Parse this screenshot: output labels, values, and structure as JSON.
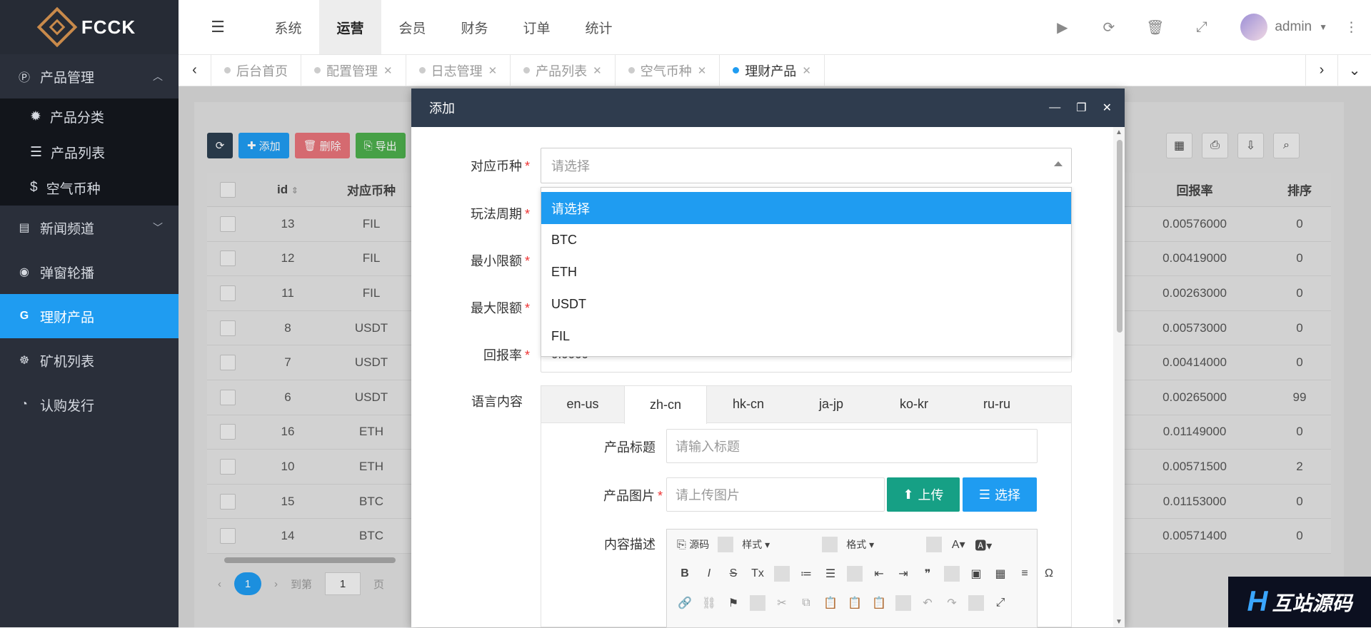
{
  "app": {
    "brand": "FCCK"
  },
  "sidebar": {
    "items": [
      {
        "label": "产品管理",
        "icon": "product-icon",
        "expanded": true
      },
      {
        "label": "新闻频道",
        "icon": "news-icon"
      },
      {
        "label": "弹窗轮播",
        "icon": "compass-icon"
      },
      {
        "label": "理财产品",
        "icon": "g-icon",
        "active": true
      },
      {
        "label": "矿机列表",
        "icon": "miner-icon"
      },
      {
        "label": "认购发行",
        "icon": "pie-icon"
      }
    ],
    "subitems": [
      {
        "label": "产品分类",
        "icon": "gear-icon"
      },
      {
        "label": "产品列表",
        "icon": "list-icon"
      },
      {
        "label": "空气币种",
        "icon": "coin-icon"
      }
    ]
  },
  "topnav": {
    "items": [
      "系统",
      "运营",
      "会员",
      "财务",
      "订单",
      "统计"
    ],
    "active": "运营",
    "user": "admin"
  },
  "tabs": [
    {
      "label": "后台首页",
      "closable": false
    },
    {
      "label": "配置管理",
      "closable": true
    },
    {
      "label": "日志管理",
      "closable": true
    },
    {
      "label": "产品列表",
      "closable": true
    },
    {
      "label": "空气币种",
      "closable": true
    },
    {
      "label": "理财产品",
      "closable": true,
      "active": true
    }
  ],
  "toolbar": {
    "add": "添加",
    "delete": "删除",
    "export": "导出"
  },
  "table": {
    "headers": {
      "id": "id",
      "coin": "对应币种",
      "rate": "回报率",
      "sort": "排序"
    },
    "rows": [
      {
        "id": "13",
        "coin": "FIL",
        "rate": "0.00576000",
        "sort": "0"
      },
      {
        "id": "12",
        "coin": "FIL",
        "rate": "0.00419000",
        "sort": "0"
      },
      {
        "id": "11",
        "coin": "FIL",
        "rate": "0.00263000",
        "sort": "0"
      },
      {
        "id": "8",
        "coin": "USDT",
        "rate": "0.00573000",
        "sort": "0"
      },
      {
        "id": "7",
        "coin": "USDT",
        "rate": "0.00414000",
        "sort": "0"
      },
      {
        "id": "6",
        "coin": "USDT",
        "rate": "0.00265000",
        "sort": "99"
      },
      {
        "id": "16",
        "coin": "ETH",
        "rate": "0.01149000",
        "sort": "0"
      },
      {
        "id": "10",
        "coin": "ETH",
        "rate": "0.00571500",
        "sort": "2"
      },
      {
        "id": "15",
        "coin": "BTC",
        "rate": "0.01153000",
        "sort": "0"
      },
      {
        "id": "14",
        "coin": "BTC",
        "rate": "0.00571400",
        "sort": "0"
      }
    ]
  },
  "pager": {
    "current": "1",
    "goto_label": "到第",
    "page_input": "1",
    "page_label": "页"
  },
  "modal": {
    "title": "添加",
    "labels": {
      "coin": "对应币种",
      "cycle": "玩法周期",
      "min": "最小限额",
      "max": "最大限额",
      "rate": "回报率",
      "lang": "语言内容",
      "title": "产品标题",
      "image": "产品图片",
      "desc": "内容描述"
    },
    "coin_placeholder": "请选择",
    "rate_value": "0.0000",
    "options": [
      "请选择",
      "BTC",
      "ETH",
      "USDT",
      "FIL"
    ],
    "lang_tabs": [
      "en-us",
      "zh-cn",
      "hk-cn",
      "ja-jp",
      "ko-kr",
      "ru-ru"
    ],
    "active_lang": "zh-cn",
    "title_placeholder": "请输入标题",
    "image_placeholder": "请上传图片",
    "upload_label": "上传",
    "choose_label": "选择",
    "editor": {
      "source": "源码",
      "style": "样式",
      "format": "格式"
    }
  },
  "watermark": {
    "text": "互站源码"
  }
}
